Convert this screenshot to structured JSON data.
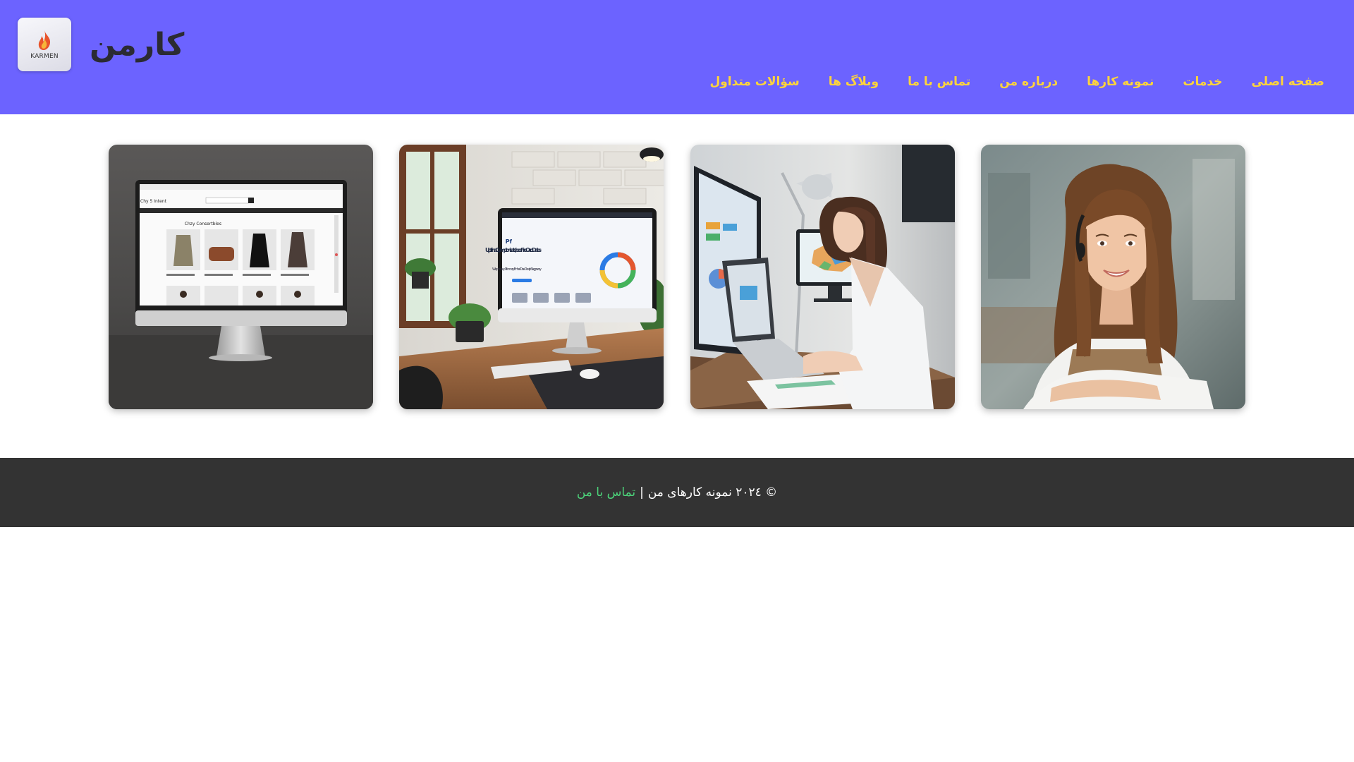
{
  "header": {
    "site_title": "کارمن",
    "logo": {
      "icon": "flame-icon",
      "text": "KARMEN"
    },
    "nav": [
      {
        "label": "صفحه اصلی"
      },
      {
        "label": "خدمات"
      },
      {
        "label": "نمونه کارها"
      },
      {
        "label": "درباره من"
      },
      {
        "label": "تماس با ما"
      },
      {
        "label": "وبلاگ ها"
      },
      {
        "label": "سؤالات متداول"
      }
    ]
  },
  "gallery": {
    "items": [
      {
        "name": "portfolio-ecommerce-monitor"
      },
      {
        "name": "portfolio-website-desk"
      },
      {
        "name": "portfolio-woman-working"
      },
      {
        "name": "portfolio-woman-portrait"
      }
    ],
    "mockup_texts": {
      "shop_logo": "Chy 5 Intent",
      "shop_heading": "Chzy Consertbles",
      "site_heading": "Upfrin a Cy mplonicats, bes fire Oco Dales",
      "site_sub": "We pme up Tremery Enhal Oos Desip Slagprwry",
      "site_brand": "Pf"
    }
  },
  "footer": {
    "copyright": "© ۲۰۲٤ نمونه کارهای من",
    "separator": "|",
    "contact_link": "تماس با من"
  },
  "colors": {
    "header_bg": "#6c63ff",
    "nav_text": "#ffd43b",
    "footer_bg": "#333333",
    "footer_link": "#4cd37a"
  }
}
